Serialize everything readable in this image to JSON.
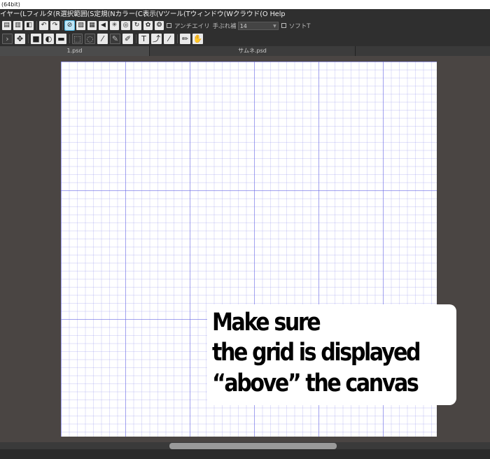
{
  "window": {
    "title": "(64bit)"
  },
  "menu": {
    "items": [
      "イヤー(L",
      "フィルタ(R",
      "選択範囲(S",
      "定規(N",
      "カラー(C",
      "表示(V",
      "ツール(T",
      "ウィンドウ(W",
      "クラウド(O",
      "Help"
    ]
  },
  "toolbar1": {
    "antialias_label": "アンチエイリ",
    "stabilizer_label": "手ぶれ補",
    "stabilizer_value": "14",
    "soft_label": "ソフトT"
  },
  "toolbar2": {
    "text_tool_glyph": "T"
  },
  "tabs": [
    {
      "label": "1.psd"
    },
    {
      "label": "サムネ.psd"
    }
  ],
  "annotation": {
    "line1": "Make sure",
    "line2": "the grid is displayed",
    "line3": "“above” the canvas"
  },
  "colors": {
    "ui_dark": "#2f2f2f",
    "workspace": "#4a4543",
    "grid": "#8c8ce6",
    "selected_tool": "#bfe6f7"
  }
}
